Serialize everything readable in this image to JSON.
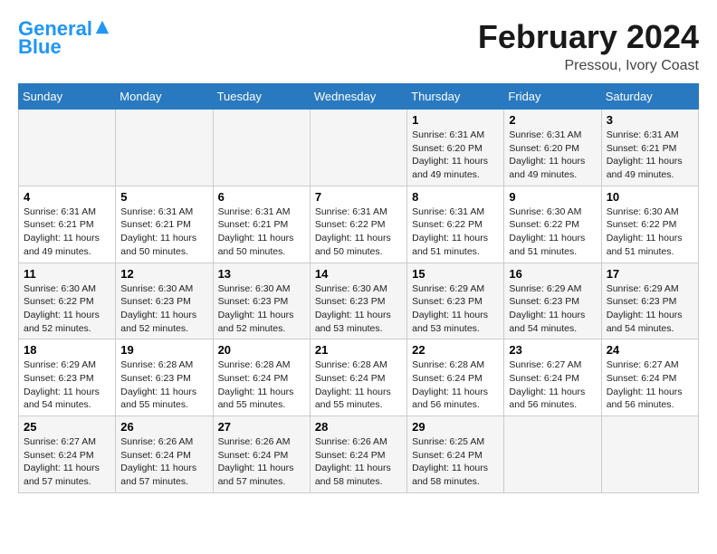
{
  "logo": {
    "line1": "General",
    "line2": "Blue"
  },
  "title": "February 2024",
  "subtitle": "Pressou, Ivory Coast",
  "days_of_week": [
    "Sunday",
    "Monday",
    "Tuesday",
    "Wednesday",
    "Thursday",
    "Friday",
    "Saturday"
  ],
  "weeks": [
    [
      {
        "day": "",
        "info": ""
      },
      {
        "day": "",
        "info": ""
      },
      {
        "day": "",
        "info": ""
      },
      {
        "day": "",
        "info": ""
      },
      {
        "day": "1",
        "info": "Sunrise: 6:31 AM\nSunset: 6:20 PM\nDaylight: 11 hours\nand 49 minutes."
      },
      {
        "day": "2",
        "info": "Sunrise: 6:31 AM\nSunset: 6:20 PM\nDaylight: 11 hours\nand 49 minutes."
      },
      {
        "day": "3",
        "info": "Sunrise: 6:31 AM\nSunset: 6:21 PM\nDaylight: 11 hours\nand 49 minutes."
      }
    ],
    [
      {
        "day": "4",
        "info": "Sunrise: 6:31 AM\nSunset: 6:21 PM\nDaylight: 11 hours\nand 49 minutes."
      },
      {
        "day": "5",
        "info": "Sunrise: 6:31 AM\nSunset: 6:21 PM\nDaylight: 11 hours\nand 50 minutes."
      },
      {
        "day": "6",
        "info": "Sunrise: 6:31 AM\nSunset: 6:21 PM\nDaylight: 11 hours\nand 50 minutes."
      },
      {
        "day": "7",
        "info": "Sunrise: 6:31 AM\nSunset: 6:22 PM\nDaylight: 11 hours\nand 50 minutes."
      },
      {
        "day": "8",
        "info": "Sunrise: 6:31 AM\nSunset: 6:22 PM\nDaylight: 11 hours\nand 51 minutes."
      },
      {
        "day": "9",
        "info": "Sunrise: 6:30 AM\nSunset: 6:22 PM\nDaylight: 11 hours\nand 51 minutes."
      },
      {
        "day": "10",
        "info": "Sunrise: 6:30 AM\nSunset: 6:22 PM\nDaylight: 11 hours\nand 51 minutes."
      }
    ],
    [
      {
        "day": "11",
        "info": "Sunrise: 6:30 AM\nSunset: 6:22 PM\nDaylight: 11 hours\nand 52 minutes."
      },
      {
        "day": "12",
        "info": "Sunrise: 6:30 AM\nSunset: 6:23 PM\nDaylight: 11 hours\nand 52 minutes."
      },
      {
        "day": "13",
        "info": "Sunrise: 6:30 AM\nSunset: 6:23 PM\nDaylight: 11 hours\nand 52 minutes."
      },
      {
        "day": "14",
        "info": "Sunrise: 6:30 AM\nSunset: 6:23 PM\nDaylight: 11 hours\nand 53 minutes."
      },
      {
        "day": "15",
        "info": "Sunrise: 6:29 AM\nSunset: 6:23 PM\nDaylight: 11 hours\nand 53 minutes."
      },
      {
        "day": "16",
        "info": "Sunrise: 6:29 AM\nSunset: 6:23 PM\nDaylight: 11 hours\nand 54 minutes."
      },
      {
        "day": "17",
        "info": "Sunrise: 6:29 AM\nSunset: 6:23 PM\nDaylight: 11 hours\nand 54 minutes."
      }
    ],
    [
      {
        "day": "18",
        "info": "Sunrise: 6:29 AM\nSunset: 6:23 PM\nDaylight: 11 hours\nand 54 minutes."
      },
      {
        "day": "19",
        "info": "Sunrise: 6:28 AM\nSunset: 6:23 PM\nDaylight: 11 hours\nand 55 minutes."
      },
      {
        "day": "20",
        "info": "Sunrise: 6:28 AM\nSunset: 6:24 PM\nDaylight: 11 hours\nand 55 minutes."
      },
      {
        "day": "21",
        "info": "Sunrise: 6:28 AM\nSunset: 6:24 PM\nDaylight: 11 hours\nand 55 minutes."
      },
      {
        "day": "22",
        "info": "Sunrise: 6:28 AM\nSunset: 6:24 PM\nDaylight: 11 hours\nand 56 minutes."
      },
      {
        "day": "23",
        "info": "Sunrise: 6:27 AM\nSunset: 6:24 PM\nDaylight: 11 hours\nand 56 minutes."
      },
      {
        "day": "24",
        "info": "Sunrise: 6:27 AM\nSunset: 6:24 PM\nDaylight: 11 hours\nand 56 minutes."
      }
    ],
    [
      {
        "day": "25",
        "info": "Sunrise: 6:27 AM\nSunset: 6:24 PM\nDaylight: 11 hours\nand 57 minutes."
      },
      {
        "day": "26",
        "info": "Sunrise: 6:26 AM\nSunset: 6:24 PM\nDaylight: 11 hours\nand 57 minutes."
      },
      {
        "day": "27",
        "info": "Sunrise: 6:26 AM\nSunset: 6:24 PM\nDaylight: 11 hours\nand 57 minutes."
      },
      {
        "day": "28",
        "info": "Sunrise: 6:26 AM\nSunset: 6:24 PM\nDaylight: 11 hours\nand 58 minutes."
      },
      {
        "day": "29",
        "info": "Sunrise: 6:25 AM\nSunset: 6:24 PM\nDaylight: 11 hours\nand 58 minutes."
      },
      {
        "day": "",
        "info": ""
      },
      {
        "day": "",
        "info": ""
      }
    ]
  ]
}
